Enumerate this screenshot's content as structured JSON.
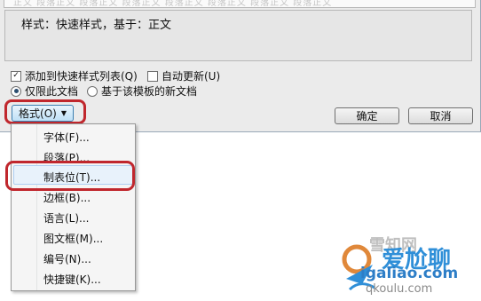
{
  "dialog": {
    "preview_text": "正文 段落正文 段落正文 段落正文 段落正文 段落正文 段落正文 段落正文",
    "description": "样式：快速样式，基于：正文",
    "add_quick_style": {
      "label": "添加到快速样式列表(Q)",
      "checked": true
    },
    "auto_update": {
      "label": "自动更新(U)",
      "checked": false
    },
    "only_this_doc": {
      "label": "仅限此文档",
      "selected": true
    },
    "new_docs_template": {
      "label": "基于该模板的新文档",
      "selected": false
    },
    "format_button": "格式(O)",
    "ok_button": "确定",
    "cancel_button": "取消"
  },
  "format_menu": {
    "items": [
      "字体(F)...",
      "段落(P)...",
      "制表位(T)...",
      "边框(B)...",
      "语言(L)...",
      "图文框(M)...",
      "编号(N)...",
      "快捷键(K)..."
    ],
    "highlighted": "制表位(T)..."
  },
  "watermark": {
    "line1": "雪知网",
    "line2": "爱尬聊",
    "line3": "igaliao.com",
    "line4": "qkoulu.com"
  },
  "colors": {
    "annotation_red": "#c0272d",
    "watermark_blue": "#2f8fd8"
  }
}
